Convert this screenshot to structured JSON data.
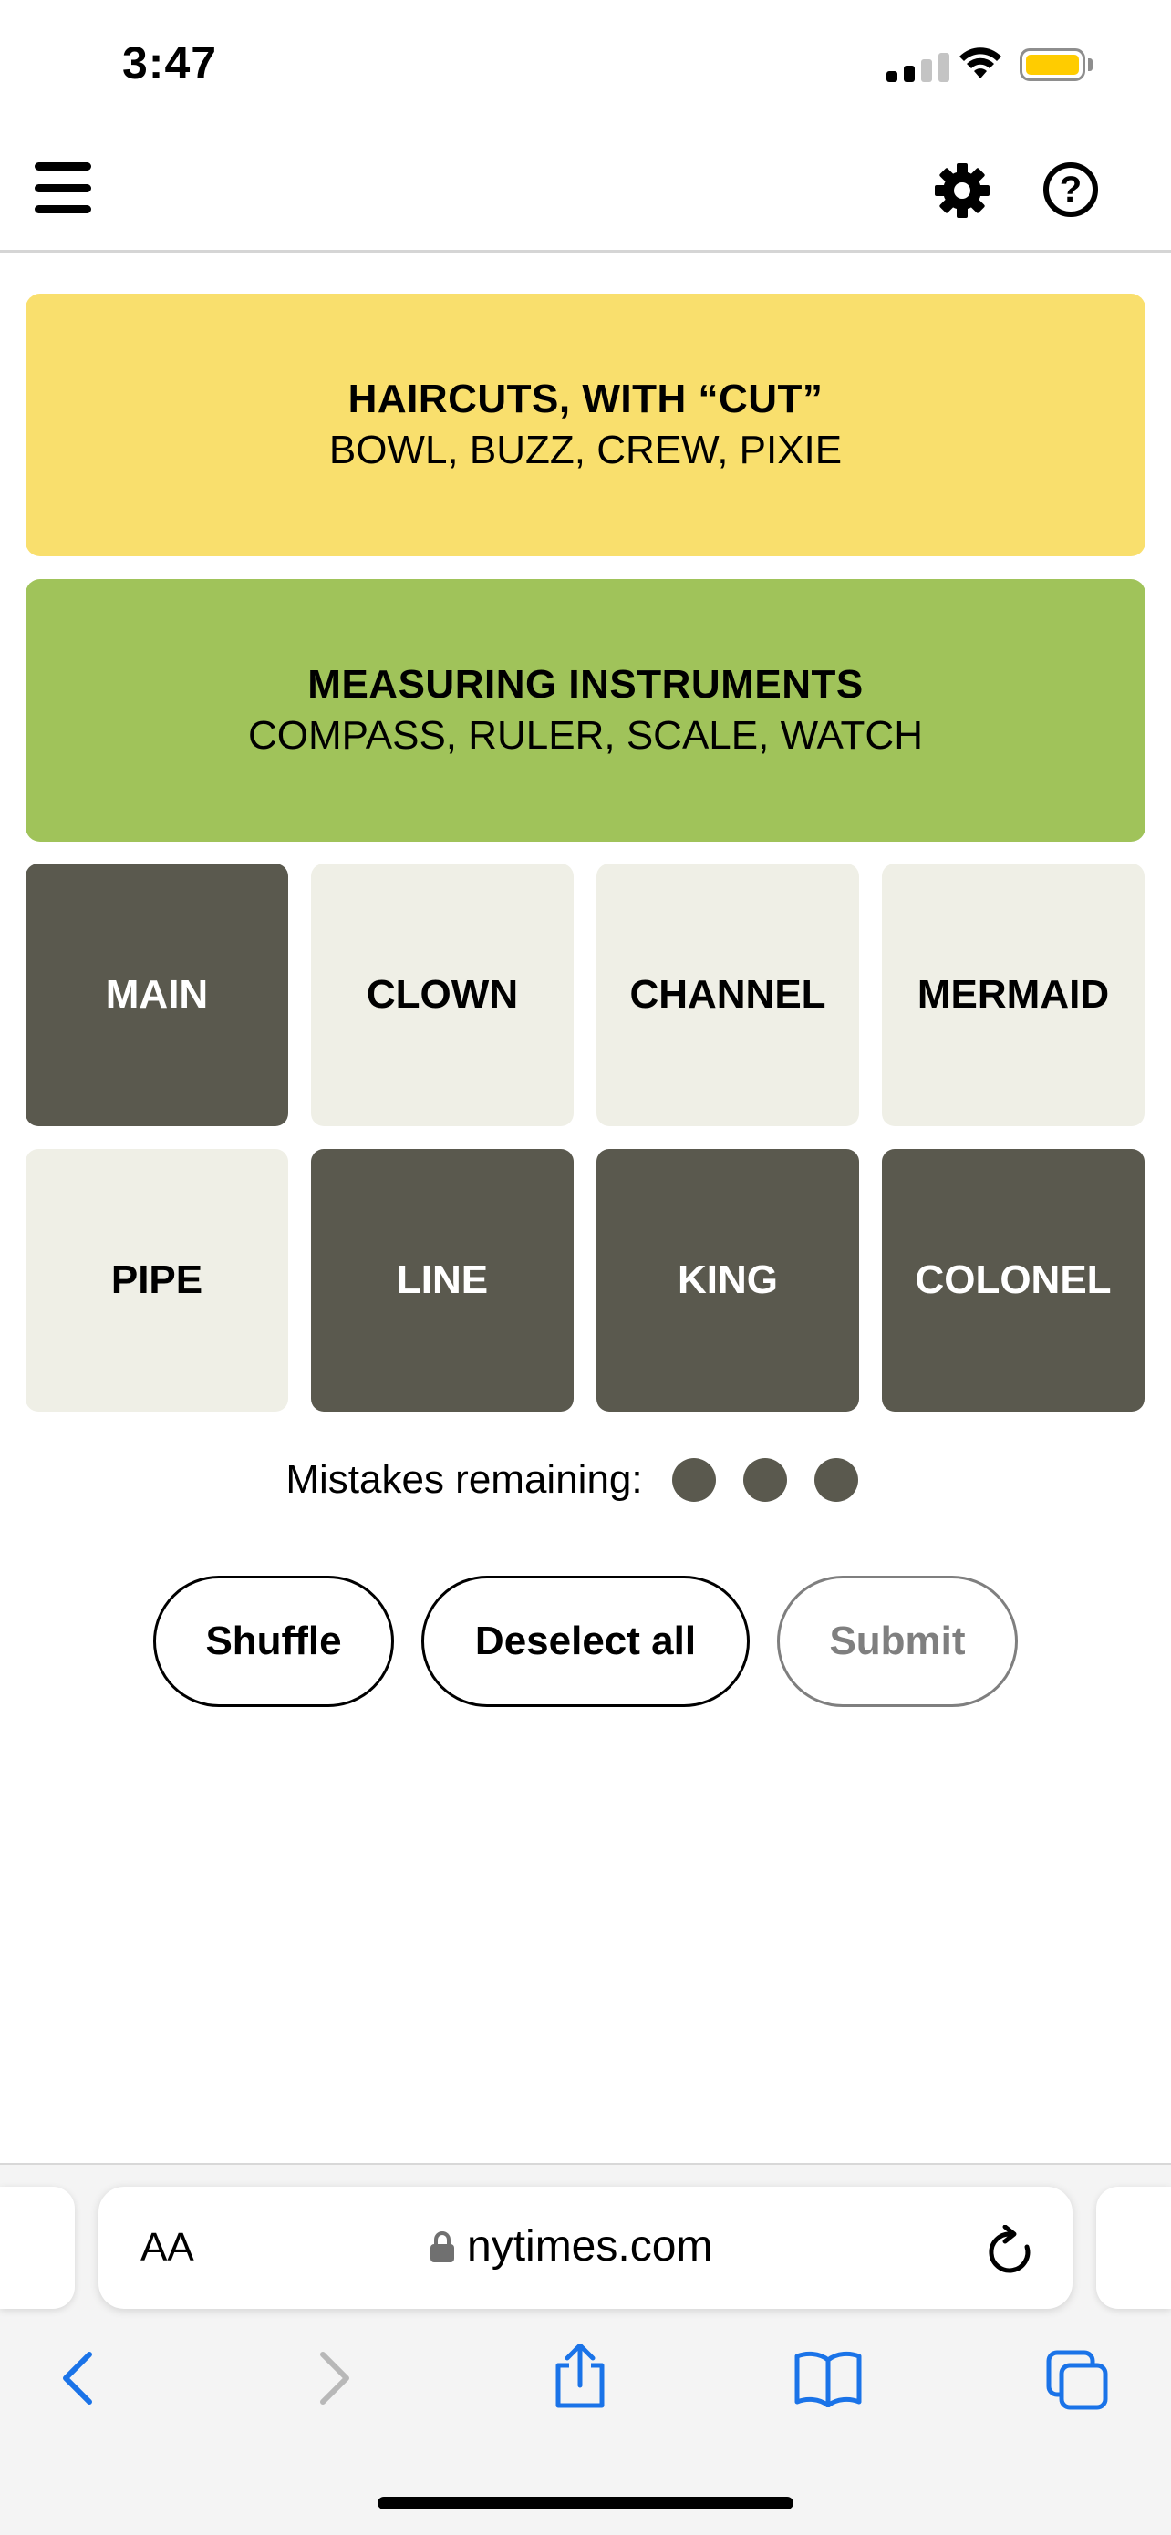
{
  "status_bar": {
    "time": "3:47"
  },
  "groups": [
    {
      "title": "HAIRCUTS, WITH “CUT”",
      "members": "BOWL, BUZZ, CREW, PIXIE",
      "color": "#f9df6d"
    },
    {
      "title": "MEASURING INSTRUMENTS",
      "members": "COMPASS, RULER, SCALE, WATCH",
      "color": "#a0c35a"
    }
  ],
  "tiles": [
    {
      "label": "MAIN",
      "selected": true
    },
    {
      "label": "CLOWN",
      "selected": false
    },
    {
      "label": "CHANNEL",
      "selected": false
    },
    {
      "label": "MERMAID",
      "selected": false
    },
    {
      "label": "PIPE",
      "selected": false
    },
    {
      "label": "LINE",
      "selected": true
    },
    {
      "label": "KING",
      "selected": true
    },
    {
      "label": "COLONEL",
      "selected": true
    }
  ],
  "mistakes": {
    "label": "Mistakes remaining:",
    "remaining": 3
  },
  "buttons": {
    "shuffle": "Shuffle",
    "deselect": "Deselect all",
    "submit": "Submit"
  },
  "browser": {
    "text_size": "AA",
    "domain": "nytimes.com"
  },
  "icons": {
    "menu": "hamburger-icon",
    "settings": "gear-icon",
    "help": "question-circle-icon",
    "lock": "lock-icon",
    "reload": "reload-icon",
    "back": "chevron-left-icon",
    "forward": "chevron-right-icon",
    "share": "share-icon",
    "bookmarks": "open-book-icon",
    "tabs": "tabs-icon"
  },
  "colors": {
    "selected_tile": "#5a594e",
    "unselected_tile": "#efefe6",
    "browser_accent": "#1a73e8"
  }
}
